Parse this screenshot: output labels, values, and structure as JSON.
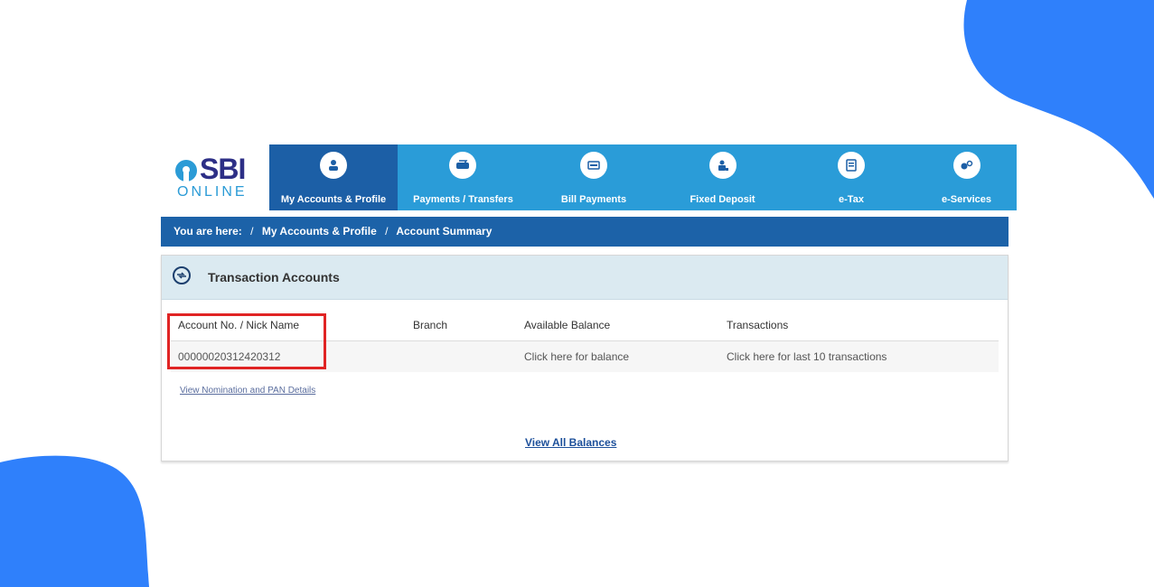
{
  "logo": {
    "sbi": "SBI",
    "online": "ONLINE"
  },
  "nav": [
    {
      "label": "My Accounts & Profile",
      "icon": "user-icon",
      "active": true
    },
    {
      "label": "Payments / Transfers",
      "icon": "transfer-icon"
    },
    {
      "label": "Bill Payments",
      "icon": "bill-icon"
    },
    {
      "label": "Fixed Deposit",
      "icon": "deposit-icon"
    },
    {
      "label": "e-Tax",
      "icon": "tax-document-icon"
    },
    {
      "label": "e-Services",
      "icon": "services-icon"
    }
  ],
  "breadcrumb": {
    "prefix": "You are here:",
    "sep": "/",
    "items": [
      "My Accounts & Profile",
      "Account Summary"
    ]
  },
  "panel": {
    "title": "Transaction Accounts",
    "icon": "transaction-icon",
    "columns": [
      "Account No. / Nick Name",
      "Branch",
      "Available Balance",
      "Transactions"
    ],
    "rows": [
      {
        "account": "00000020312420312",
        "branch": "",
        "balance": "Click here for balance",
        "transactions": "Click here for last 10 transactions"
      }
    ],
    "nomination_link": "View Nomination and PAN Details",
    "view_all": "View All Balances"
  },
  "colors": {
    "nav": "#2a9cd8",
    "nav_active": "#1c5fa6",
    "breadcrumb": "#1c62a8",
    "highlight": "#e02424",
    "blob": "#2f80fb"
  }
}
